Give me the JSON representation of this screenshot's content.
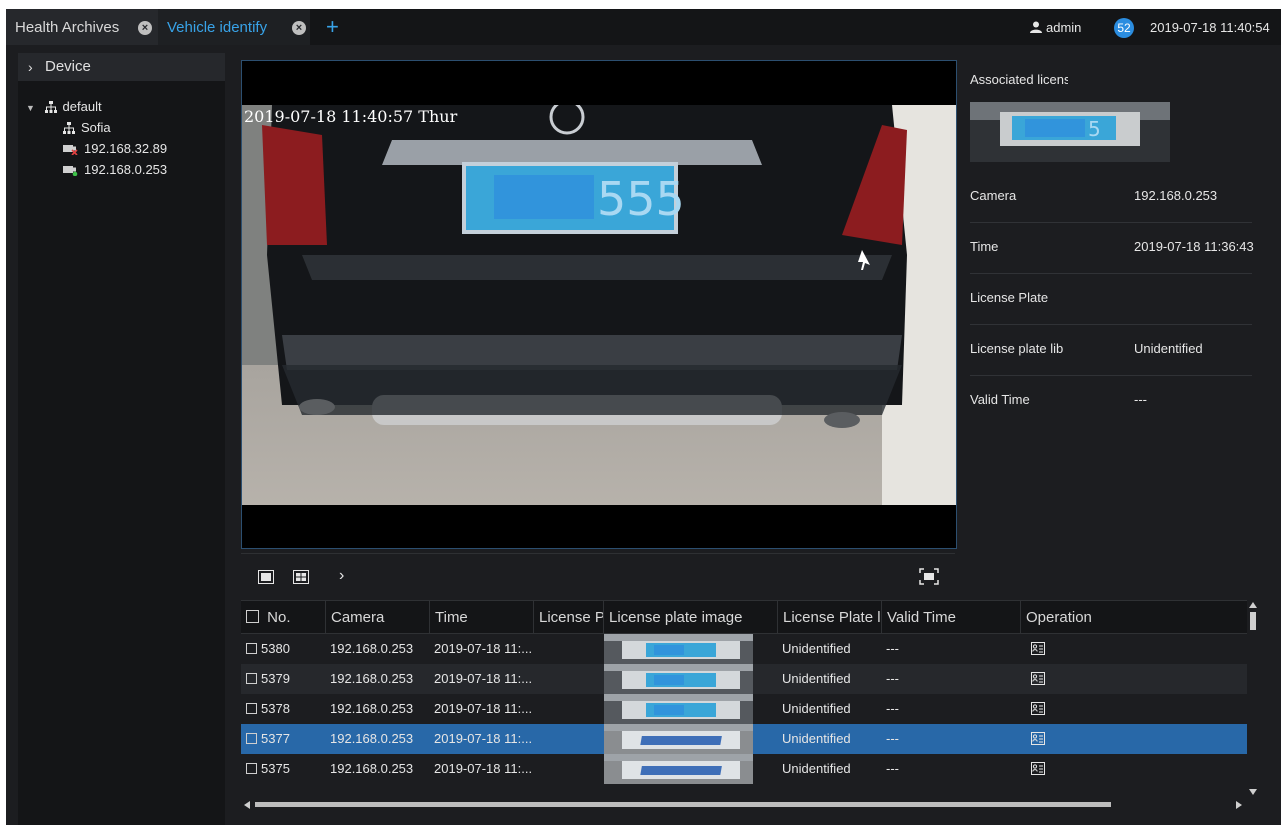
{
  "tabs": [
    {
      "label": "Health Archives",
      "active": false
    },
    {
      "label": "Vehicle identify",
      "active": true
    }
  ],
  "header": {
    "user": "admin",
    "notification_count": "52",
    "datetime": "2019-07-18 11:40:54"
  },
  "sidebar": {
    "title": "Device",
    "tree": {
      "group": "default",
      "items": [
        {
          "label": "Sofia",
          "type": "group"
        },
        {
          "label": "192.168.32.89",
          "type": "camera",
          "status": "offline"
        },
        {
          "label": "192.168.0.253",
          "type": "camera",
          "status": "online"
        }
      ]
    }
  },
  "player": {
    "osd": "2019-07-18 11:40:57 Thur",
    "plate_text": "555"
  },
  "info": {
    "title": "Associated licens",
    "thumb_text": "5",
    "rows": [
      {
        "key": "Camera",
        "value": "192.168.0.253"
      },
      {
        "key": "Time",
        "value": "2019-07-18 11:36:43"
      },
      {
        "key": "License Plate",
        "value": ""
      },
      {
        "key": "License plate lib",
        "value": "Unidentified"
      },
      {
        "key": "Valid Time",
        "value": "---"
      }
    ]
  },
  "table": {
    "headers": [
      "No.",
      "Camera",
      "Time",
      "License P",
      "License plate image",
      "License Plate l",
      "Valid Time",
      "Operation"
    ],
    "rows": [
      {
        "no": "5380",
        "camera": "192.168.0.253",
        "time": "2019-07-18 11:...",
        "plate_lib": "Unidentified",
        "valid": "---",
        "selected": false
      },
      {
        "no": "5379",
        "camera": "192.168.0.253",
        "time": "2019-07-18 11:...",
        "plate_lib": "Unidentified",
        "valid": "---",
        "selected": false
      },
      {
        "no": "5378",
        "camera": "192.168.0.253",
        "time": "2019-07-18 11:...",
        "plate_lib": "Unidentified",
        "valid": "---",
        "selected": false
      },
      {
        "no": "5377",
        "camera": "192.168.0.253",
        "time": "2019-07-18 11:...",
        "plate_lib": "Unidentified",
        "valid": "---",
        "selected": true
      },
      {
        "no": "5375",
        "camera": "192.168.0.253",
        "time": "2019-07-18 11:...",
        "plate_lib": "Unidentified",
        "valid": "---",
        "selected": false
      }
    ]
  },
  "colors": {
    "accent": "#38a3e8",
    "selected_row": "#2868a8",
    "panel": "#1c1d20"
  }
}
